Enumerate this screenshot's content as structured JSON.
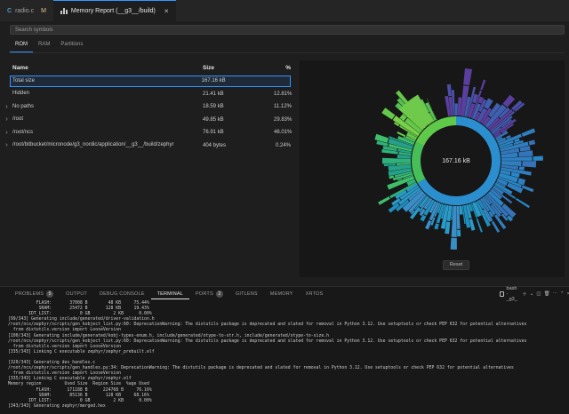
{
  "tabs": [
    {
      "label": "radio.c",
      "lang_icon": "C",
      "modified": "M"
    },
    {
      "label": "Memory Report (__g3__/build)",
      "close": "×"
    }
  ],
  "search": {
    "placeholder": "Search symbols"
  },
  "subtabs": [
    "ROM",
    "RAM",
    "Partitions"
  ],
  "table": {
    "headers": {
      "name": "Name",
      "size": "Size",
      "pct": "%"
    },
    "rows": [
      {
        "expander": "",
        "name": "Total size",
        "size": "167.16 kB",
        "pct": ""
      },
      {
        "expander": "",
        "name": "Hidden",
        "size": "21.41 kB",
        "pct": "12.81%"
      },
      {
        "expander": "›",
        "name": "No paths",
        "size": "18.59 kB",
        "pct": "11.12%"
      },
      {
        "expander": "›",
        "name": "/root",
        "size": "49.85 kB",
        "pct": "29.83%"
      },
      {
        "expander": "›",
        "name": "/root/ncs",
        "size": "76.91 kB",
        "pct": "46.01%"
      },
      {
        "expander": "›",
        "name": "/root/bitbucket/micronode/g3_nordic/application/__g3__/build/zephyr",
        "size": "404 bytes",
        "pct": "0.24%"
      }
    ]
  },
  "sunburst": {
    "center_label": "167.16 kB",
    "colors": {
      "ring": "#3fb56a",
      "blue": "#2a86c4",
      "purple": "#5a3f9e",
      "green": "#4cc24a",
      "teal": "#1e9a9a"
    }
  },
  "reset_label": "Reset",
  "panel": {
    "tabs": [
      {
        "label": "PROBLEMS",
        "badge": "5"
      },
      {
        "label": "OUTPUT",
        "badge": ""
      },
      {
        "label": "DEBUG CONSOLE",
        "badge": ""
      },
      {
        "label": "TERMINAL",
        "badge": ""
      },
      {
        "label": "PORTS",
        "badge": "2"
      },
      {
        "label": "GITLENS",
        "badge": ""
      },
      {
        "label": "MEMORY",
        "badge": ""
      },
      {
        "label": "XRTOS",
        "badge": ""
      }
    ],
    "terminal_name": "bash - _g3_"
  },
  "terminal": [
    "           FLASH:       37008 B        48 KB     75.44%",
    "            SRAM:       25472 B       128 KB     19.43%",
    "        IDT_LIST:           0 GB         2 KB      0.00%",
    "[99/343] Generating include/generated/driver-validation.h",
    "/root/ncs/zephyr/scripts/gen_kobject_list.py:60: DeprecationWarning: The distutils package is deprecated and slated for removal in Python 3.12. Use setuptools or check PEP 632 for potential alternatives",
    "  from distutils.version import LooseVersion",
    "[100/343] Generating include/generated/kobj-types-enum.h, include/generated/otype-to-str.h, include/generated/otype-to-size.h",
    "/root/ncs/zephyr/scripts/gen_kobject_list.py:60: DeprecationWarning: The distutils package is deprecated and slated for removal in Python 3.12. Use setuptools or check PEP 632 for potential alternatives",
    "  from distutils.version import LooseVersion",
    "[335/343] Linking C executable zephyr/zephyr_prebuilt.elf",
    "",
    "[320/343] Generating dev_handles.c",
    "/root/ncs/zephyr/scripts/gen_handles.py:34: DeprecationWarning: The distutils package is deprecated and slated for removal in Python 3.12. Use setuptools or check PEP 632 for potential alternatives",
    "  from distutils.version import LooseVersion",
    "[335/343] Linking C executable zephyr/zephyr.elf",
    "Memory region         Used Size  Region Size  %age Used",
    "           FLASH:      171188 B      224768 B     76.16%",
    "            SRAM:       85136 B       128 KB     68.16%",
    "        IDT_LIST:           0 GB         2 KB      0.00%",
    "[343/343] Generating zephyr/merged.hex"
  ]
}
